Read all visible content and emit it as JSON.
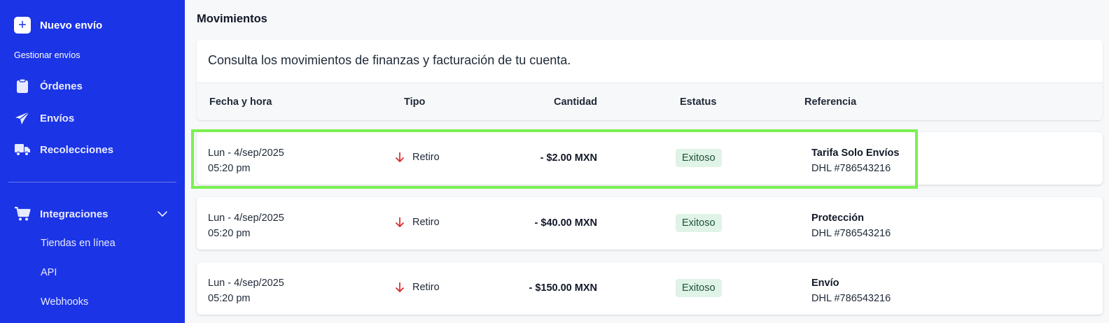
{
  "sidebar": {
    "new_shipment_label": "Nuevo envío",
    "section_label": "Gestionar envíos",
    "nav": {
      "orders": "Órdenes",
      "shipments": "Envíos",
      "pickups": "Recolecciones",
      "integrations": "Integraciones"
    },
    "sub_items": {
      "online_stores": "Tiendas en línea",
      "api": "API",
      "webhooks": "Webhooks"
    },
    "accent_color": "#1b34e6"
  },
  "main": {
    "title": "Movimientos",
    "description": "Consulta los movimientos de finanzas y facturación de tu cuenta.",
    "columns": {
      "date": "Fecha y hora",
      "type": "Tipo",
      "amount": "Cantidad",
      "status": "Estatus",
      "reference": "Referencia"
    },
    "rows": [
      {
        "date": "Lun - 4/sep/2025",
        "time": "05:20 pm",
        "type": "Retiro",
        "type_icon": "arrow-down-icon",
        "amount": "- $2.00 MXN",
        "status": "Exitoso",
        "ref_title": "Tarifa Solo Envíos",
        "ref_code": "DHL #786543216"
      },
      {
        "date": "Lun - 4/sep/2025",
        "time": "05:20 pm",
        "type": "Retiro",
        "type_icon": "arrow-down-icon",
        "amount": "- $40.00 MXN",
        "status": "Exitoso",
        "ref_title": "Protección",
        "ref_code": "DHL #786543216"
      },
      {
        "date": "Lun - 4/sep/2025",
        "time": "05:20 pm",
        "type": "Retiro",
        "type_icon": "arrow-down-icon",
        "amount": "- $150.00 MXN",
        "status": "Exitoso",
        "ref_title": "Envío",
        "ref_code": "DHL #786543216"
      }
    ],
    "status_color": "#dff3e6",
    "withdrawal_color": "#dc2626",
    "highlight_color": "#7af050"
  }
}
